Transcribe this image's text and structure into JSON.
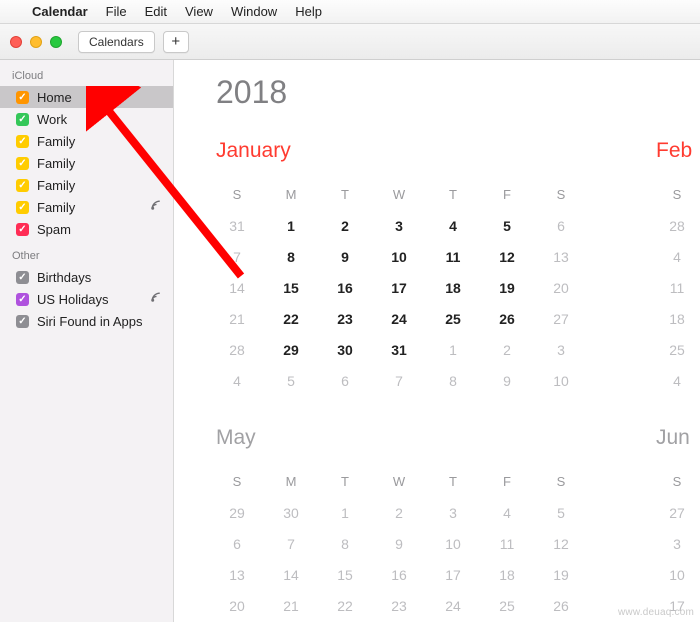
{
  "menubar": {
    "app": "Calendar",
    "items": [
      "File",
      "Edit",
      "View",
      "Window",
      "Help"
    ]
  },
  "toolbar": {
    "calendars_label": "Calendars",
    "add_label": "+"
  },
  "sidebar": {
    "sections": [
      {
        "title": "iCloud",
        "items": [
          {
            "label": "Home",
            "color": "#ff9500",
            "selected": true
          },
          {
            "label": "Work",
            "color": "#34c759"
          },
          {
            "label": "Family",
            "color": "#ffcc00"
          },
          {
            "label": "Family",
            "color": "#ffcc00"
          },
          {
            "label": "Family",
            "color": "#ffcc00"
          },
          {
            "label": "Family",
            "color": "#ffcc00",
            "shared": true
          },
          {
            "label": "Spam",
            "color": "#ff2d55"
          }
        ]
      },
      {
        "title": "Other",
        "items": [
          {
            "label": "Birthdays",
            "color": "#8e8e93"
          },
          {
            "label": "US Holidays",
            "color": "#af52de",
            "shared": true
          },
          {
            "label": "Siri Found in Apps",
            "color": "#8e8e93"
          }
        ]
      }
    ]
  },
  "content": {
    "year": "2018",
    "months": [
      {
        "name": "January",
        "highlight": true,
        "weekdays": [
          "S",
          "M",
          "T",
          "W",
          "T",
          "F",
          "S"
        ],
        "weeks": [
          [
            {
              "d": "31",
              "out": true
            },
            {
              "d": "1"
            },
            {
              "d": "2"
            },
            {
              "d": "3"
            },
            {
              "d": "4"
            },
            {
              "d": "5"
            },
            {
              "d": "6",
              "out": true
            }
          ],
          [
            {
              "d": "7",
              "out": true
            },
            {
              "d": "8"
            },
            {
              "d": "9"
            },
            {
              "d": "10"
            },
            {
              "d": "11"
            },
            {
              "d": "12"
            },
            {
              "d": "13",
              "out": true
            }
          ],
          [
            {
              "d": "14",
              "out": true
            },
            {
              "d": "15"
            },
            {
              "d": "16"
            },
            {
              "d": "17"
            },
            {
              "d": "18"
            },
            {
              "d": "19"
            },
            {
              "d": "20",
              "out": true
            }
          ],
          [
            {
              "d": "21",
              "out": true
            },
            {
              "d": "22"
            },
            {
              "d": "23"
            },
            {
              "d": "24"
            },
            {
              "d": "25"
            },
            {
              "d": "26"
            },
            {
              "d": "27",
              "out": true
            }
          ],
          [
            {
              "d": "28",
              "out": true
            },
            {
              "d": "29"
            },
            {
              "d": "30"
            },
            {
              "d": "31"
            },
            {
              "d": "1",
              "out": true
            },
            {
              "d": "2",
              "out": true
            },
            {
              "d": "3",
              "out": true
            }
          ],
          [
            {
              "d": "4",
              "out": true
            },
            {
              "d": "5",
              "out": true
            },
            {
              "d": "6",
              "out": true
            },
            {
              "d": "7",
              "out": true
            },
            {
              "d": "8",
              "out": true
            },
            {
              "d": "9",
              "out": true
            },
            {
              "d": "10",
              "out": true
            }
          ]
        ]
      },
      {
        "name": "Feb",
        "highlight": true,
        "weekdays": [
          "S"
        ],
        "weeks": [
          [
            {
              "d": "28",
              "out": true
            }
          ],
          [
            {
              "d": "4",
              "out": true
            }
          ],
          [
            {
              "d": "11",
              "out": true
            }
          ],
          [
            {
              "d": "18",
              "out": true
            }
          ],
          [
            {
              "d": "25",
              "out": true
            }
          ],
          [
            {
              "d": "4",
              "out": true
            }
          ]
        ]
      }
    ],
    "months_row2": [
      {
        "name": "May",
        "highlight": false,
        "weekdays": [
          "S",
          "M",
          "T",
          "W",
          "T",
          "F",
          "S"
        ],
        "weeks": [
          [
            {
              "d": "29",
              "out": true
            },
            {
              "d": "30",
              "out": true
            },
            {
              "d": "1",
              "out": true
            },
            {
              "d": "2",
              "out": true
            },
            {
              "d": "3",
              "out": true
            },
            {
              "d": "4",
              "out": true
            },
            {
              "d": "5",
              "out": true
            }
          ],
          [
            {
              "d": "6",
              "out": true
            },
            {
              "d": "7",
              "out": true
            },
            {
              "d": "8",
              "out": true
            },
            {
              "d": "9",
              "out": true
            },
            {
              "d": "10",
              "out": true
            },
            {
              "d": "11",
              "out": true
            },
            {
              "d": "12",
              "out": true
            }
          ],
          [
            {
              "d": "13",
              "out": true
            },
            {
              "d": "14",
              "out": true
            },
            {
              "d": "15",
              "out": true
            },
            {
              "d": "16",
              "out": true
            },
            {
              "d": "17",
              "out": true
            },
            {
              "d": "18",
              "out": true
            },
            {
              "d": "19",
              "out": true
            }
          ],
          [
            {
              "d": "20",
              "out": true
            },
            {
              "d": "21",
              "out": true
            },
            {
              "d": "22",
              "out": true
            },
            {
              "d": "23",
              "out": true
            },
            {
              "d": "24",
              "out": true
            },
            {
              "d": "25",
              "out": true
            },
            {
              "d": "26",
              "out": true
            }
          ]
        ]
      },
      {
        "name": "Jun",
        "highlight": false,
        "weekdays": [
          "S"
        ],
        "weeks": [
          [
            {
              "d": "27",
              "out": true
            }
          ],
          [
            {
              "d": "3",
              "out": true
            }
          ],
          [
            {
              "d": "10",
              "out": true
            }
          ],
          [
            {
              "d": "17",
              "out": true
            }
          ]
        ]
      }
    ]
  },
  "watermark": "www.deuaq.com"
}
